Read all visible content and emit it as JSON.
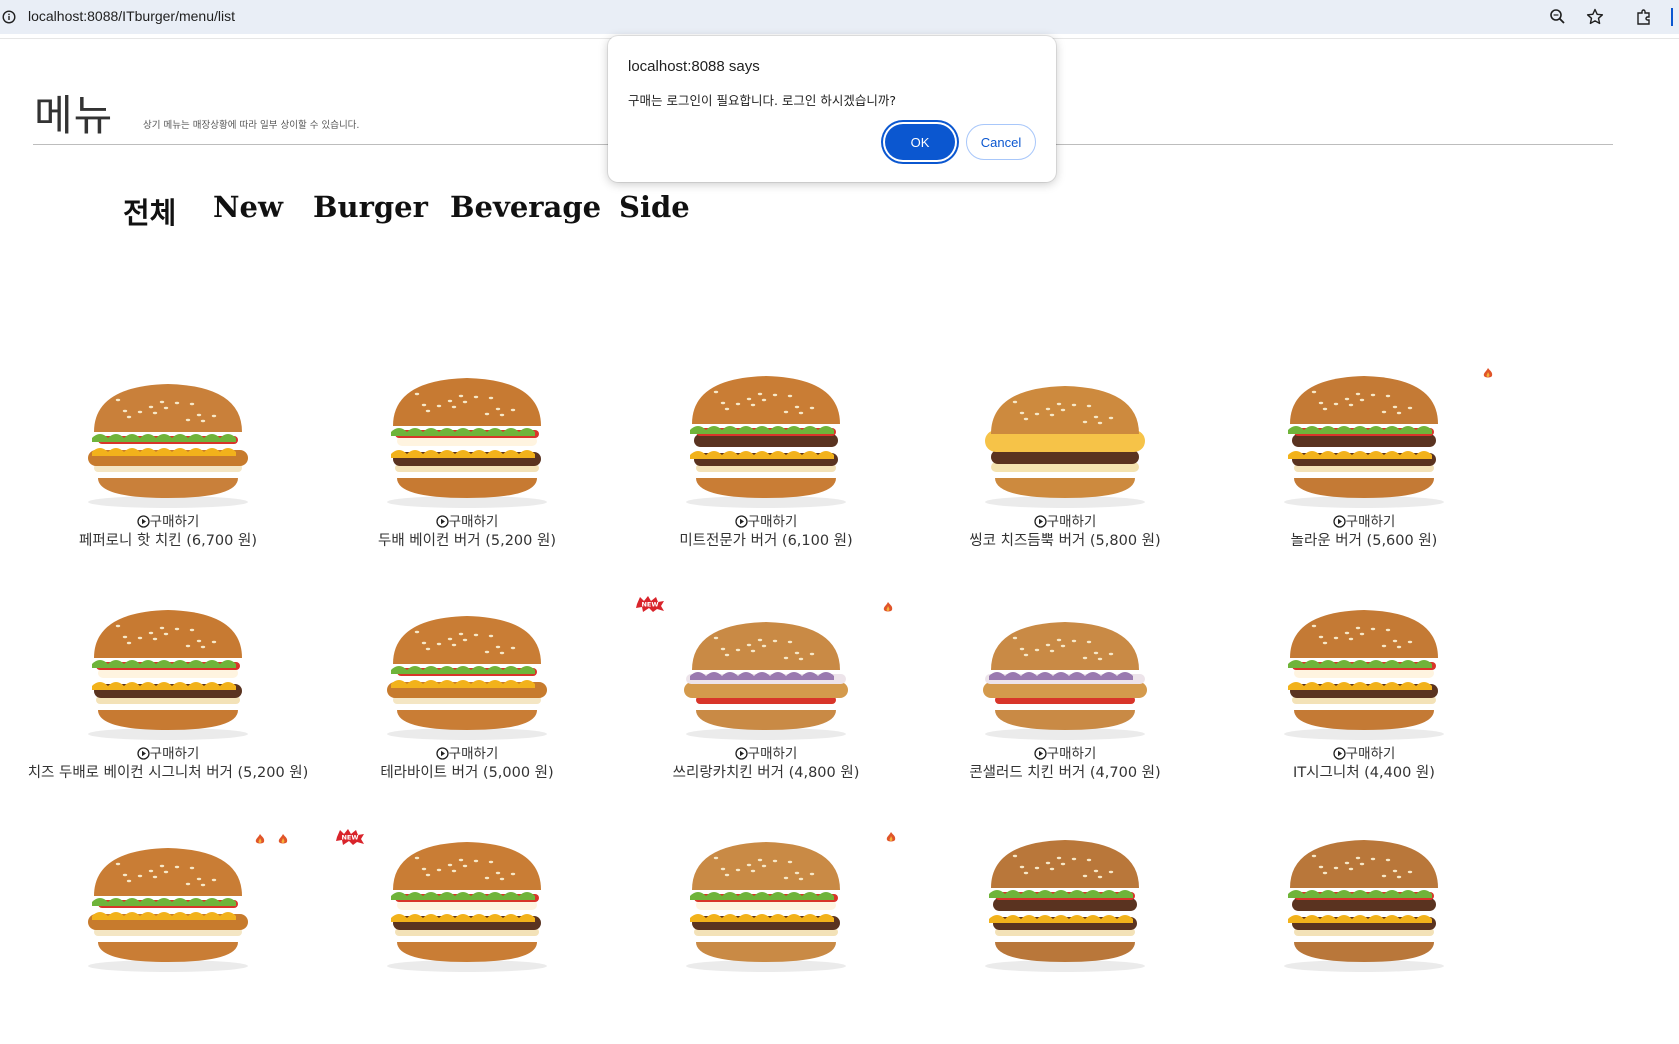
{
  "browser": {
    "url": "localhost:8088/ITburger/menu/list"
  },
  "page": {
    "title": "메뉴",
    "note": "상기 메뉴는 매장상황에 따라 일부 상이할 수 있습니다."
  },
  "nav": {
    "items": [
      {
        "label": "전체"
      },
      {
        "label": "New"
      },
      {
        "label": "Burger"
      },
      {
        "label": "Beverage"
      },
      {
        "label": "Side"
      }
    ]
  },
  "buy_label": "구매하기",
  "badges": {
    "new": "NEW"
  },
  "menu": [
    {
      "name": "페퍼로니 핫 치킨 (6,700 원)",
      "bun": "#c9803a",
      "style": "chicken"
    },
    {
      "name": "두배 베이컨 버거 (5,200 원)",
      "bun": "#c77a32",
      "style": "beef"
    },
    {
      "name": "미트전문가 버거 (6,100 원)",
      "bun": "#c97d35",
      "style": "double"
    },
    {
      "name": "씽코 치즈듬뿍 버거 (5,800 원)",
      "bun": "#cd8a3e",
      "style": "cheese"
    },
    {
      "name": "놀라운 버거 (5,600 원)",
      "bun": "#c47a35",
      "style": "double"
    },
    {
      "name": "치즈 두배로 베이컨 시그니처 버거 (5,200 원)",
      "bun": "#c77a32",
      "style": "beef"
    },
    {
      "name": "테라바이트 버거 (5,000 원)",
      "bun": "#c97d35",
      "style": "chicken"
    },
    {
      "name": "쓰리랑카치킨 버거 (4,800 원)",
      "bun": "#c98a45",
      "style": "slaw"
    },
    {
      "name": "콘샐러드 치킨 버거 (4,700 원)",
      "bun": "#c98a45",
      "style": "slaw"
    },
    {
      "name": "IT시그니처 (4,400 원)",
      "bun": "#c47a35",
      "style": "beef"
    },
    {
      "name": "",
      "bun": "#c97d35",
      "style": "chicken"
    },
    {
      "name": "",
      "bun": "#c97d35",
      "style": "beef"
    },
    {
      "name": "",
      "bun": "#c98a45",
      "style": "beef"
    },
    {
      "name": "",
      "bun": "#b9773a",
      "style": "double"
    },
    {
      "name": "",
      "bun": "#b9773a",
      "style": "double"
    }
  ],
  "dialog": {
    "title": "localhost:8088 says",
    "message": "구매는 로그인이 필요합니다. 로그인 하시겠습니까?",
    "ok": "OK",
    "cancel": "Cancel"
  },
  "colors": {
    "accent": "#0b57d0",
    "addressbar": "#e9eef6",
    "tomato": "#d8352a",
    "lettuce": "#6fb43a",
    "cheese": "#f2b21b",
    "patty": "#5a3320"
  },
  "icons": [
    "info-icon",
    "zoom-icon",
    "star-icon",
    "extension-icon",
    "play-circle-icon",
    "fire-icon",
    "new-badge-icon"
  ]
}
